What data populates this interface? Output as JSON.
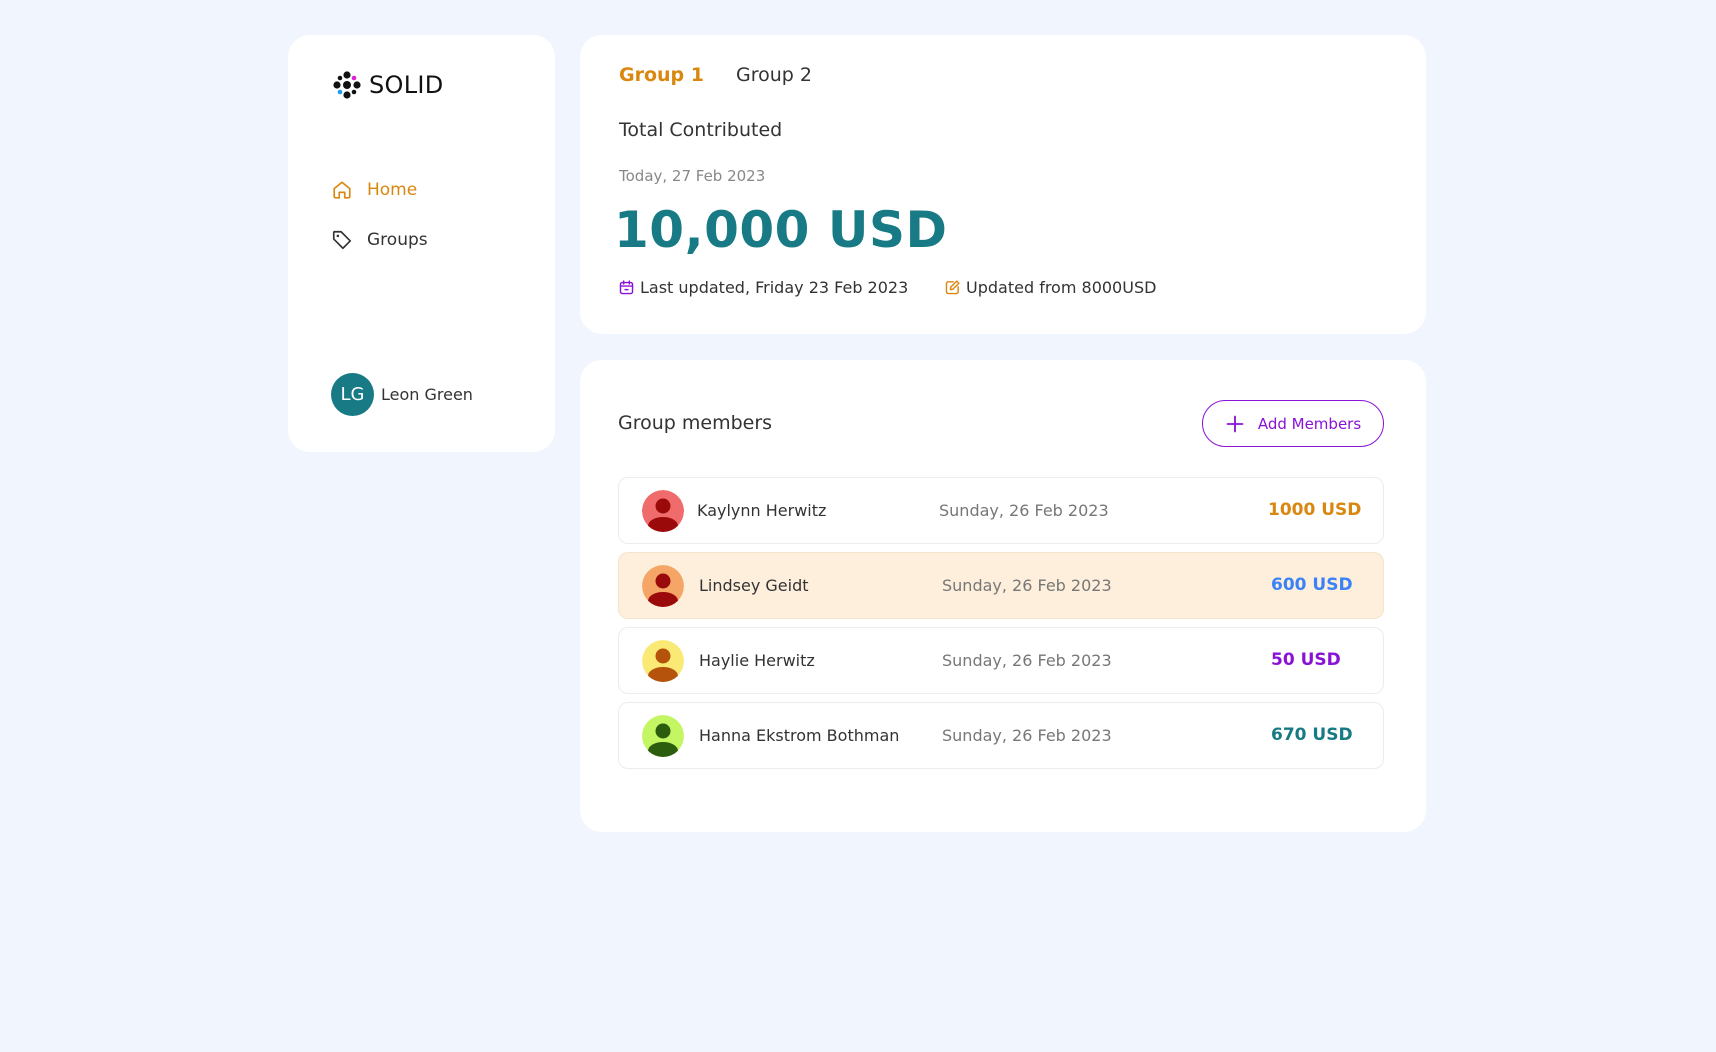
{
  "brand": {
    "name": "SOLID"
  },
  "nav": {
    "home": "Home",
    "groups": "Groups"
  },
  "user": {
    "initials": "LG",
    "name": "Leon Green"
  },
  "tabs": [
    {
      "label": "Group 1"
    },
    {
      "label": "Group 2"
    }
  ],
  "summary": {
    "label": "Total Contributed",
    "today": "Today, 27 Feb 2023",
    "amount": "10,000 USD",
    "last_updated": "Last updated, Friday 23 Feb 2023",
    "updated_from": "Updated from 8000USD"
  },
  "members": {
    "title": "Group members",
    "add_label": "Add Members",
    "rows": [
      {
        "name": "Kaylynn Herwitz",
        "date": "Sunday, 26 Feb 2023",
        "amount": "1000 USD",
        "color": "#d9870f"
      },
      {
        "name": "Lindsey Geidt",
        "date": "Sunday, 26 Feb 2023",
        "amount": "600 USD",
        "color": "#3b82f6"
      },
      {
        "name": "Haylie Herwitz",
        "date": "Sunday, 26 Feb 2023",
        "amount": "50 USD",
        "color": "#8a12d6"
      },
      {
        "name": "Hanna Ekstrom Bothman",
        "date": "Sunday, 26 Feb 2023",
        "amount": "670 USD",
        "color": "#177a84"
      }
    ]
  },
  "colors": {
    "accent": "#d9870f",
    "primary": "#177a84",
    "purple": "#8a12d6",
    "background": "#f1f5fd"
  }
}
